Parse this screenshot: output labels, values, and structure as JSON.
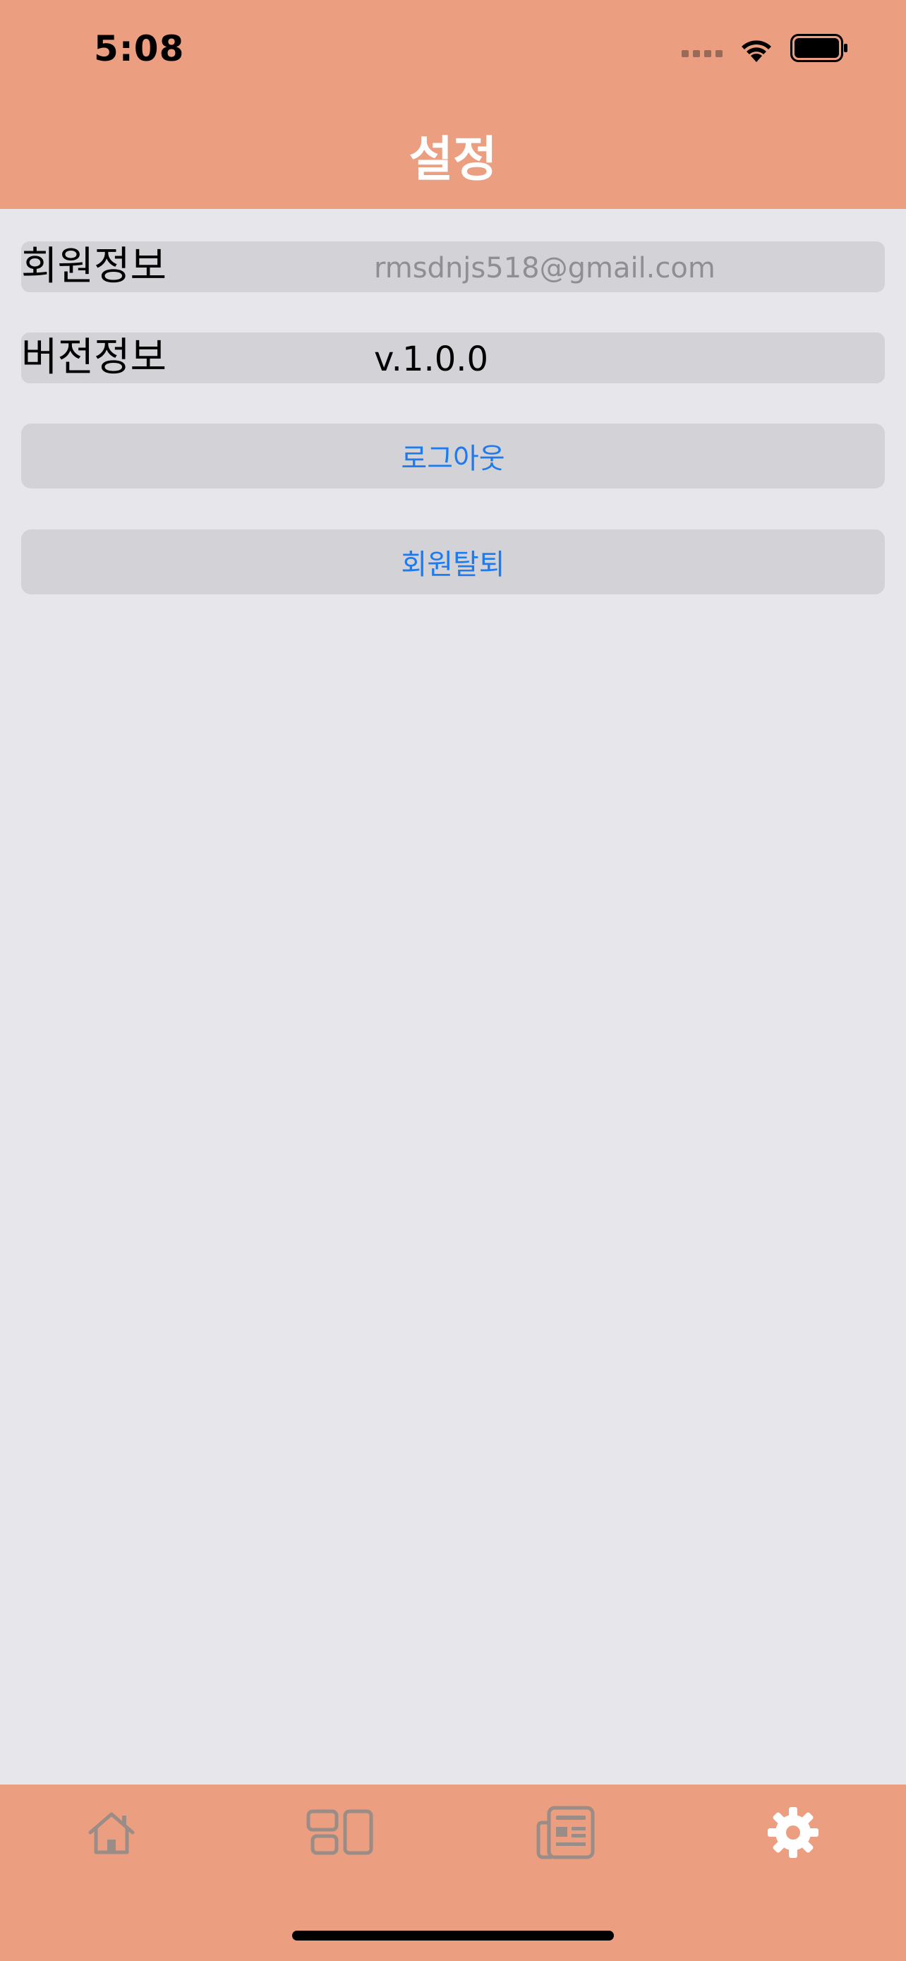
{
  "status_bar": {
    "time": "5:08",
    "icons": [
      "signal-icon",
      "wifi-icon",
      "battery-icon"
    ]
  },
  "nav": {
    "title": "설정"
  },
  "settings": {
    "member_info": {
      "label": "회원정보",
      "value": "rmsdnjs518@gmail.com"
    },
    "version_info": {
      "label": "버전정보",
      "value": "v.1.0.0"
    },
    "logout_label": "로그아웃",
    "withdraw_label": "회원탈퇴"
  },
  "tabbar": {
    "items": [
      {
        "icon": "home-icon",
        "active": false
      },
      {
        "icon": "layout-icon",
        "active": false
      },
      {
        "icon": "news-icon",
        "active": false
      },
      {
        "icon": "gear-icon",
        "active": true
      }
    ]
  },
  "colors": {
    "brand": "#EB9E80",
    "background": "#E7E6EB",
    "row_background": "#D3D2D7",
    "link_blue": "#1C7BF0",
    "tab_inactive": "#9A8C87",
    "tab_active": "#FFFFFF"
  }
}
